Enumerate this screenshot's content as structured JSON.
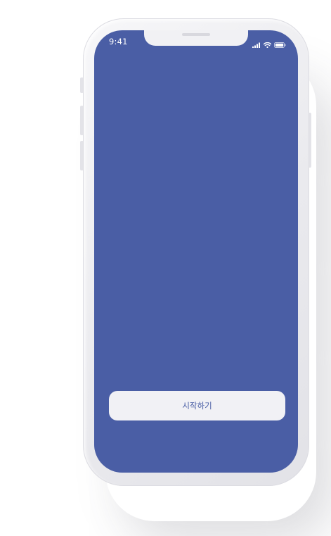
{
  "status_bar": {
    "time": "9:41",
    "icons": [
      "cellular-signal-icon",
      "wifi-icon",
      "battery-icon"
    ]
  },
  "main": {
    "start_button_label": "시작하기"
  },
  "colors": {
    "screen_background": "#4a5ea5",
    "button_background": "#f1f1f5",
    "button_text": "#4a5ea5",
    "phone_frame": "#ececf0"
  }
}
